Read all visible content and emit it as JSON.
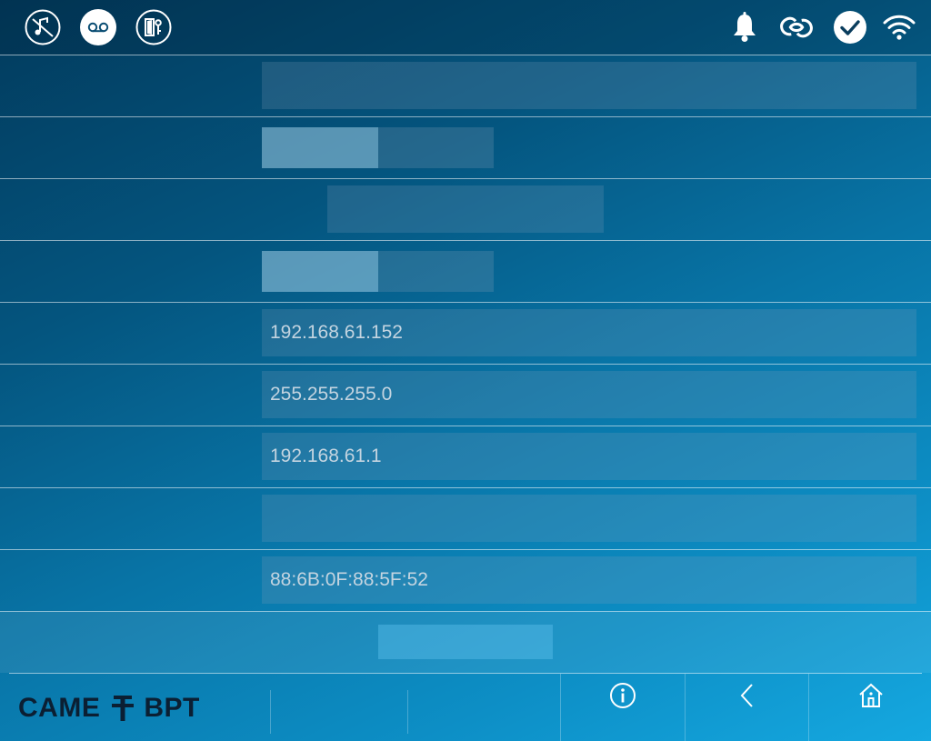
{
  "status_bar": {
    "left_icons": [
      "music-off-icon",
      "voicemail-icon",
      "door-key-icon"
    ],
    "right_icons": [
      "bell-icon",
      "cloud-link-icon",
      "check-icon",
      "wifi-icon"
    ]
  },
  "network_settings": {
    "rows": [
      {
        "label": "",
        "value": ""
      },
      {
        "label": "",
        "toggle": {
          "on": "",
          "off": ""
        }
      },
      {
        "label": "",
        "value": ""
      },
      {
        "label": "",
        "toggle": {
          "on": "",
          "off": ""
        }
      },
      {
        "label": "",
        "value": "192.168.61.152"
      },
      {
        "label": "",
        "value": "255.255.255.0"
      },
      {
        "label": "",
        "value": "192.168.61.1"
      },
      {
        "label": "",
        "value": ""
      },
      {
        "label": "",
        "value": "88:6B:0F:88:5F:52"
      }
    ],
    "action_label": ""
  },
  "bottom_bar": {
    "brand_left": "CAME",
    "brand_right": "BPT",
    "nav_icons": [
      "info-icon",
      "back-chevron-icon",
      "home-icon"
    ]
  }
}
